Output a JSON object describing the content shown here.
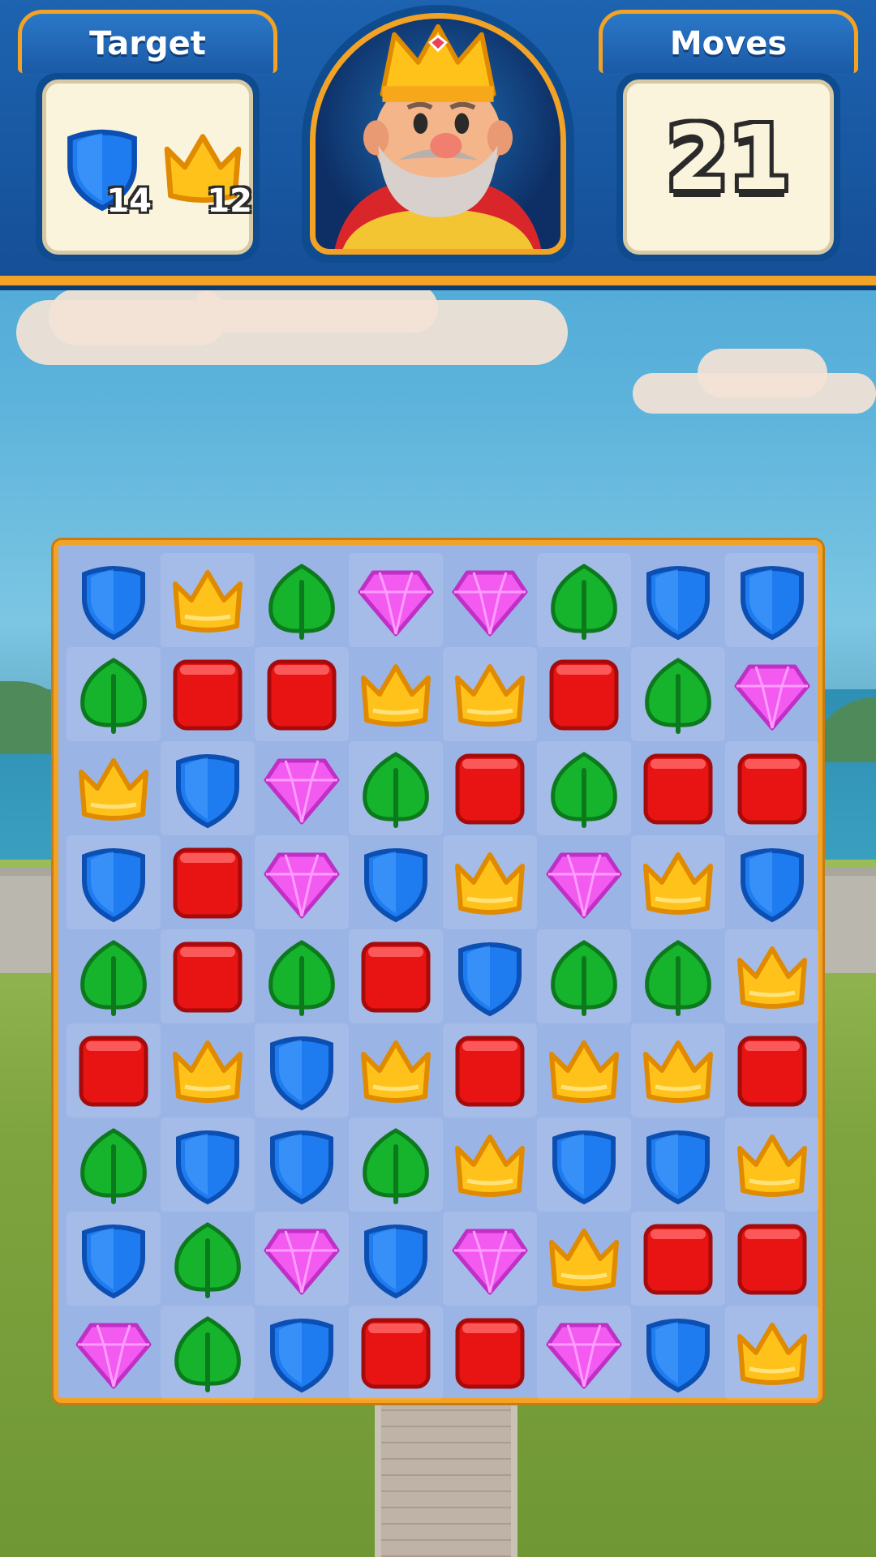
{
  "header": {
    "target_label": "Target",
    "moves_label": "Moves",
    "moves_value": "21",
    "targets": [
      {
        "piece": "blue-shield",
        "count": "14"
      },
      {
        "piece": "yellow-crown",
        "count": "12"
      }
    ],
    "portrait": "king-character"
  },
  "pieces": {
    "B": {
      "name": "blue-shield",
      "color": "#1e7cf0"
    },
    "Y": {
      "name": "yellow-crown",
      "color": "#ffc21a"
    },
    "G": {
      "name": "green-leaf",
      "color": "#16b32c"
    },
    "P": {
      "name": "pink-gem",
      "color": "#f25af0"
    },
    "R": {
      "name": "red-box",
      "color": "#e81414"
    }
  },
  "board": {
    "rows": [
      [
        "B",
        "Y",
        "G",
        "P",
        "P",
        "G",
        "B",
        "B"
      ],
      [
        "G",
        "R",
        "R",
        "Y",
        "Y",
        "R",
        "G",
        "P"
      ],
      [
        "Y",
        "B",
        "P",
        "G",
        "R",
        "G",
        "R",
        "R"
      ],
      [
        "B",
        "R",
        "P",
        "B",
        "Y",
        "P",
        "Y",
        "B"
      ],
      [
        "G",
        "R",
        "G",
        "R",
        "B",
        "G",
        "G",
        "Y"
      ],
      [
        "R",
        "Y",
        "B",
        "Y",
        "R",
        "Y",
        "Y",
        "R"
      ],
      [
        "G",
        "B",
        "B",
        "G",
        "Y",
        "B",
        "B",
        "Y"
      ],
      [
        "B",
        "G",
        "P",
        "B",
        "P",
        "Y",
        "R",
        "R"
      ],
      [
        "P",
        "G",
        "B",
        "R",
        "R",
        "P",
        "B",
        "Y"
      ]
    ]
  }
}
